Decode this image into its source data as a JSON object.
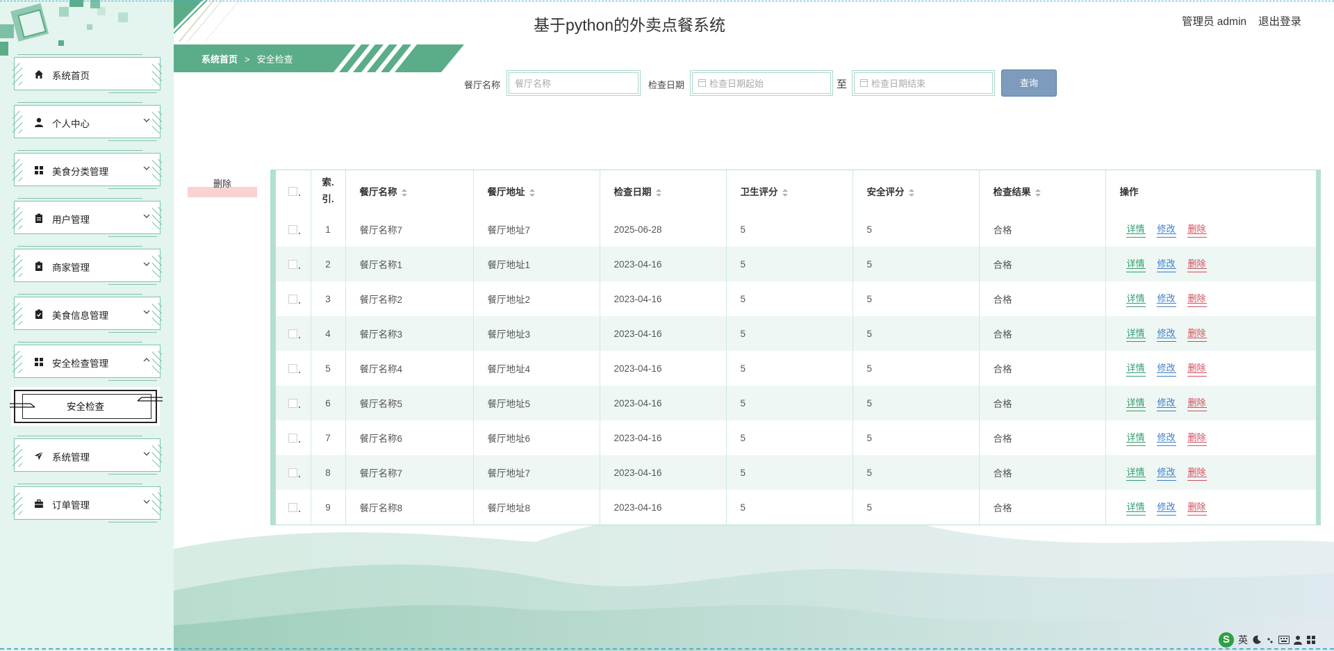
{
  "app": {
    "title": "基于python的外卖点餐系统",
    "user": "管理员 admin",
    "logout": "退出登录",
    "colors": {
      "primary": "#5aad88",
      "sidebar_bg": "#e4f4ee",
      "query_btn": "#7c9bbd",
      "delete_bg": "#f9d2d2"
    }
  },
  "breadcrumb": {
    "home": "系统首页",
    "separator": ">",
    "current": "安全检查"
  },
  "sidebar": {
    "items": [
      {
        "label": "系统首页",
        "icon": "home-icon",
        "expandable": false
      },
      {
        "label": "个人中心",
        "icon": "user-icon",
        "expandable": true
      },
      {
        "label": "美食分类管理",
        "icon": "grid-icon",
        "expandable": true
      },
      {
        "label": "用户管理",
        "icon": "clipboard-icon",
        "expandable": true
      },
      {
        "label": "商家管理",
        "icon": "clipboard-x-icon",
        "expandable": true
      },
      {
        "label": "美食信息管理",
        "icon": "clipboard-check-icon",
        "expandable": true
      },
      {
        "label": "安全检查管理",
        "icon": "grid-icon",
        "expandable": true,
        "expanded": true
      },
      {
        "label": "系统管理",
        "icon": "paper-plane-icon",
        "expandable": true
      },
      {
        "label": "订单管理",
        "icon": "briefcase-icon",
        "expandable": true
      }
    ],
    "sub_item": "安全检查"
  },
  "search": {
    "restaurant_label": "餐厅名称",
    "restaurant_placeholder": "餐厅名称",
    "date_label": "检查日期",
    "date_start_placeholder": "检查日期起始",
    "date_to": "至",
    "date_end_placeholder": "检查日期结束",
    "query_button": "查询"
  },
  "actions": {
    "delete_button": "删除"
  },
  "table": {
    "columns": [
      "索引",
      "餐厅名称",
      "餐厅地址",
      "检查日期",
      "卫生评分",
      "安全评分",
      "检查结果",
      "操作"
    ],
    "index_header_line1": "索.",
    "index_header_line2": "引.",
    "op_labels": {
      "detail": "详情",
      "edit": "修改",
      "delete": "删除"
    },
    "rows": [
      {
        "idx": "1",
        "name": "餐厅名称7",
        "addr": "餐厅地址7",
        "date": "2025-06-28",
        "hygiene": "5",
        "safety": "5",
        "result": "合格"
      },
      {
        "idx": "2",
        "name": "餐厅名称1",
        "addr": "餐厅地址1",
        "date": "2023-04-16",
        "hygiene": "5",
        "safety": "5",
        "result": "合格"
      },
      {
        "idx": "3",
        "name": "餐厅名称2",
        "addr": "餐厅地址2",
        "date": "2023-04-16",
        "hygiene": "5",
        "safety": "5",
        "result": "合格"
      },
      {
        "idx": "4",
        "name": "餐厅名称3",
        "addr": "餐厅地址3",
        "date": "2023-04-16",
        "hygiene": "5",
        "safety": "5",
        "result": "合格"
      },
      {
        "idx": "5",
        "name": "餐厅名称4",
        "addr": "餐厅地址4",
        "date": "2023-04-16",
        "hygiene": "5",
        "safety": "5",
        "result": "合格"
      },
      {
        "idx": "6",
        "name": "餐厅名称5",
        "addr": "餐厅地址5",
        "date": "2023-04-16",
        "hygiene": "5",
        "safety": "5",
        "result": "合格"
      },
      {
        "idx": "7",
        "name": "餐厅名称6",
        "addr": "餐厅地址6",
        "date": "2023-04-16",
        "hygiene": "5",
        "safety": "5",
        "result": "合格"
      },
      {
        "idx": "8",
        "name": "餐厅名称7",
        "addr": "餐厅地址7",
        "date": "2023-04-16",
        "hygiene": "5",
        "safety": "5",
        "result": "合格"
      },
      {
        "idx": "9",
        "name": "餐厅名称8",
        "addr": "餐厅地址8",
        "date": "2023-04-16",
        "hygiene": "5",
        "safety": "5",
        "result": "合格"
      }
    ]
  },
  "tray": {
    "ime_lang": "英"
  }
}
